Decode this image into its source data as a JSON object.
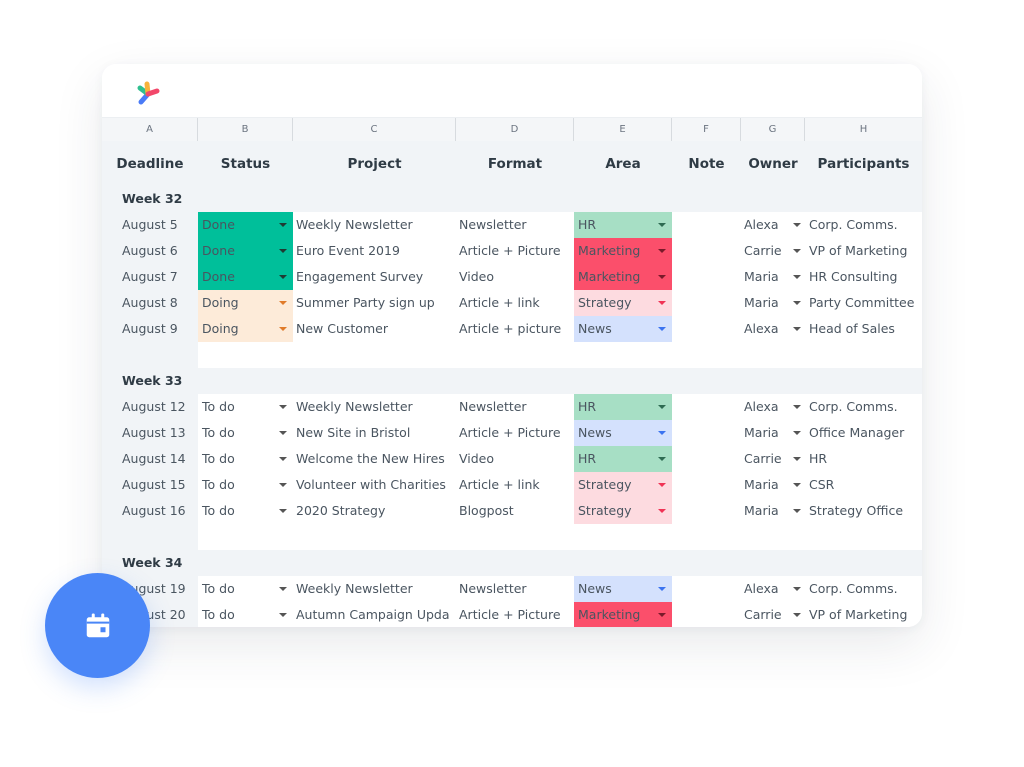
{
  "columns": [
    "A",
    "B",
    "C",
    "D",
    "E",
    "F",
    "G",
    "H"
  ],
  "headers": {
    "deadline": "Deadline",
    "status": "Status",
    "project": "Project",
    "format": "Format",
    "area": "Area",
    "note": "Note",
    "owner": "Owner",
    "participants": "Participants"
  },
  "colors": {
    "status": {
      "Done": "#00bf9a",
      "Doing": "#fdebd9",
      "To do": "#ffffff"
    },
    "status_caret": {
      "Done": "#1f3b33",
      "Doing": "#e07b2a",
      "To do": "#555555"
    },
    "area": {
      "HR": "#a7dfc5",
      "Marketing": "#fb4f6b",
      "Strategy": "#fddbe0",
      "News": "#d4e1fd"
    },
    "area_caret": {
      "HR": "#2e6b52",
      "Marketing": "#7a1a2a",
      "Strategy": "#f03355",
      "News": "#3b73f0"
    },
    "accent": "#4a86f7"
  },
  "weeks": [
    {
      "label": "Week 32",
      "rows": [
        {
          "deadline": "August 5",
          "status": "Done",
          "project": "Weekly Newsletter",
          "format": "Newsletter",
          "area": "HR",
          "note": "",
          "owner": "Alexa",
          "participants": "Corp. Comms."
        },
        {
          "deadline": "August 6",
          "status": "Done",
          "project": "Euro Event 2019",
          "format": "Article + Picture",
          "area": "Marketing",
          "note": "",
          "owner": "Carrie",
          "participants": "VP of Marketing"
        },
        {
          "deadline": "August 7",
          "status": "Done",
          "project": "Engagement Survey",
          "format": "Video",
          "area": "Marketing",
          "note": "",
          "owner": "Maria",
          "participants": "HR Consulting"
        },
        {
          "deadline": "August 8",
          "status": "Doing",
          "project": "Summer Party sign up",
          "format": "Article + link",
          "area": "Strategy",
          "note": "",
          "owner": "Maria",
          "participants": "Party Committee"
        },
        {
          "deadline": "August 9",
          "status": "Doing",
          "project": "New Customer",
          "format": "Article + picture",
          "area": "News",
          "note": "",
          "owner": "Alexa",
          "participants": "Head of Sales"
        }
      ]
    },
    {
      "label": "Week 33",
      "rows": [
        {
          "deadline": "August 12",
          "status": "To do",
          "project": "Weekly Newsletter",
          "format": "Newsletter",
          "area": "HR",
          "note": "",
          "owner": "Alexa",
          "participants": "Corp. Comms."
        },
        {
          "deadline": "August 13",
          "status": "To do",
          "project": "New Site in Bristol",
          "format": "Article + Picture",
          "area": "News",
          "note": "",
          "owner": "Maria",
          "participants": "Office Manager"
        },
        {
          "deadline": "August 14",
          "status": "To do",
          "project": "Welcome the New Hires",
          "format": "Video",
          "area": "HR",
          "note": "",
          "owner": "Carrie",
          "participants": "HR"
        },
        {
          "deadline": "August 15",
          "status": "To do",
          "project": "Volunteer with Charities",
          "format": "Article + link",
          "area": "Strategy",
          "note": "",
          "owner": "Maria",
          "participants": "CSR"
        },
        {
          "deadline": "August 16",
          "status": "To do",
          "project": "2020 Strategy",
          "format": "Blogpost",
          "area": "Strategy",
          "note": "",
          "owner": "Maria",
          "participants": "Strategy Office"
        }
      ]
    },
    {
      "label": "Week 34",
      "rows": [
        {
          "deadline": "August 19",
          "status": "To do",
          "project": "Weekly Newsletter",
          "format": "Newsletter",
          "area": "News",
          "note": "",
          "owner": "Alexa",
          "participants": "Corp. Comms."
        },
        {
          "deadline": "August 20",
          "status": "To do",
          "project": "Autumn Campaign Upda",
          "format": "Article + Picture",
          "area": "Marketing",
          "note": "",
          "owner": "Carrie",
          "participants": "VP of Marketing"
        }
      ]
    }
  ],
  "icons": {
    "logo": "app-logo-icon",
    "fab": "calendar-icon"
  }
}
